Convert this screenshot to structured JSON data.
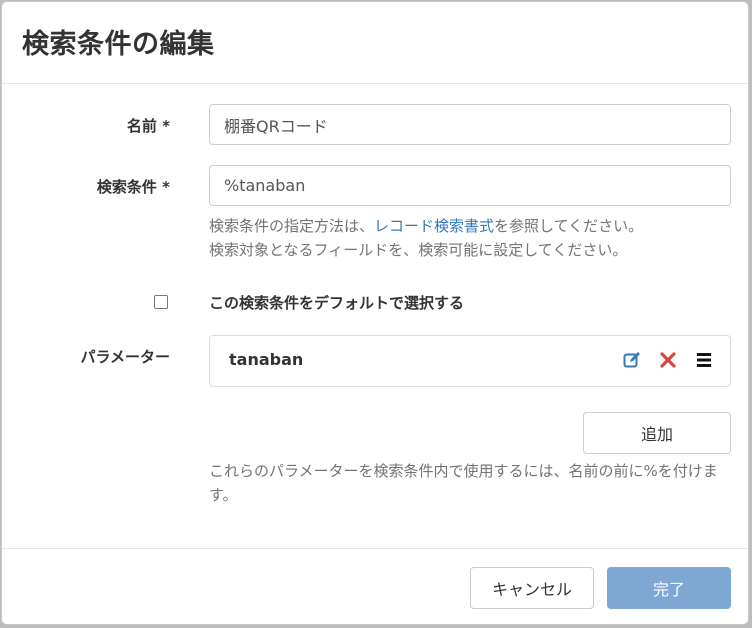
{
  "dialog": {
    "title": "検索条件の編集"
  },
  "form": {
    "name": {
      "label": "名前 *",
      "value": "棚番QRコード"
    },
    "query": {
      "label": "検索条件 *",
      "value": "%tanaban",
      "help_prefix": "検索条件の指定方法は、",
      "help_link": "レコード検索書式",
      "help_suffix": "を参照してください。",
      "help_line2": "検索対象となるフィールドを、検索可能に設定してください。"
    },
    "default_checkbox": {
      "label": "この検索条件をデフォルトで選択する",
      "checked": false
    },
    "parameters": {
      "label": "パラメーター",
      "items": [
        {
          "name": "tanaban"
        }
      ],
      "add_label": "追加",
      "help": "これらのパラメーターを検索条件内で使用するには、名前の前に%を付けます。"
    }
  },
  "footer": {
    "cancel_label": "キャンセル",
    "done_label": "完了"
  },
  "colors": {
    "link": "#337ab7",
    "primary_disabled": "#7fa7d3",
    "edit_icon": "#337ab7",
    "delete_icon": "#d9453d"
  },
  "icons": {
    "edit": "edit-icon",
    "delete": "delete-icon",
    "drag": "drag-handle-icon"
  }
}
